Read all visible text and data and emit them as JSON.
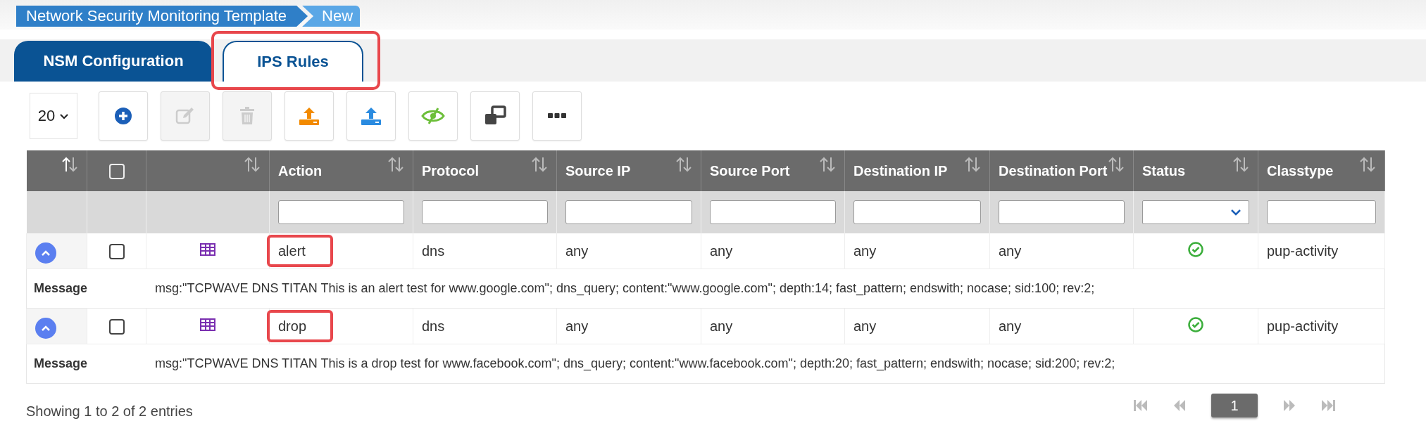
{
  "breadcrumb": [
    {
      "label": "Network Security Monitoring Template"
    },
    {
      "label": "New"
    }
  ],
  "tabs": [
    {
      "label": "NSM Configuration",
      "selected": false,
      "highlighted": false
    },
    {
      "label": "IPS Rules",
      "selected": true,
      "highlighted": true
    }
  ],
  "toolbar": {
    "page_size": "20",
    "buttons": [
      {
        "kind": "add",
        "disabled": false
      },
      {
        "kind": "edit",
        "disabled": true
      },
      {
        "kind": "delete",
        "disabled": true
      },
      {
        "kind": "import",
        "disabled": false
      },
      {
        "kind": "export",
        "disabled": false
      },
      {
        "kind": "hide",
        "disabled": false
      },
      {
        "kind": "windows",
        "disabled": false
      },
      {
        "kind": "more",
        "disabled": false
      }
    ]
  },
  "table": {
    "columns": [
      {
        "kind": "expand",
        "sorted": true
      },
      {
        "kind": "checkbox",
        "checked": false
      },
      {
        "kind": "icon",
        "sorted": false
      },
      {
        "kind": "text",
        "label": "Action",
        "sorted": false,
        "filter": {
          "kind": "text"
        }
      },
      {
        "kind": "text",
        "label": "Protocol",
        "sorted": false,
        "filter": {
          "kind": "text"
        }
      },
      {
        "kind": "text",
        "label": "Source IP",
        "sorted": false,
        "filter": {
          "kind": "text"
        }
      },
      {
        "kind": "text",
        "label": "Source Port",
        "sorted": false,
        "filter": {
          "kind": "text"
        }
      },
      {
        "kind": "text",
        "label": "Destination IP",
        "sorted": false,
        "filter": {
          "kind": "text"
        }
      },
      {
        "kind": "text",
        "label": "Destination Port",
        "sorted": false,
        "filter": {
          "kind": "text"
        }
      },
      {
        "kind": "text",
        "label": "Status",
        "sorted": false,
        "filter": {
          "kind": "select"
        }
      },
      {
        "kind": "text",
        "label": "Classtype",
        "sorted": false,
        "filter": {
          "kind": "text"
        }
      }
    ],
    "rows": [
      {
        "expanded": true,
        "checked": false,
        "action": "alert",
        "action_highlighted": true,
        "protocol": "dns",
        "source_ip": "any",
        "source_port": "any",
        "destination_ip": "any",
        "destination_port": "any",
        "enabled": true,
        "classtype": "pup-activity",
        "message_label": "Message",
        "message": "msg:\"TCPWAVE DNS TITAN This is an alert test for www.google.com\"; dns_query; content:\"www.google.com\"; depth:14; fast_pattern; endswith; nocase; sid:100; rev:2;"
      },
      {
        "expanded": true,
        "checked": false,
        "action": "drop",
        "action_highlighted": true,
        "protocol": "dns",
        "source_ip": "any",
        "source_port": "any",
        "destination_ip": "any",
        "destination_port": "any",
        "enabled": true,
        "classtype": "pup-activity",
        "message_label": "Message",
        "message": "msg:\"TCPWAVE DNS TITAN This is a drop test for www.facebook.com\"; dns_query; content:\"www.facebook.com\"; depth:20; fast_pattern; endswith; nocase; sid:200; rev:2;"
      }
    ]
  },
  "footer": {
    "info": "Showing 1 to 2 of 2 entries",
    "pages": [
      {
        "kind": "first",
        "disabled": true
      },
      {
        "kind": "prev",
        "disabled": true
      },
      {
        "kind": "page",
        "label": "1",
        "selected": true
      },
      {
        "kind": "next",
        "disabled": true
      },
      {
        "kind": "last",
        "disabled": true
      }
    ]
  }
}
